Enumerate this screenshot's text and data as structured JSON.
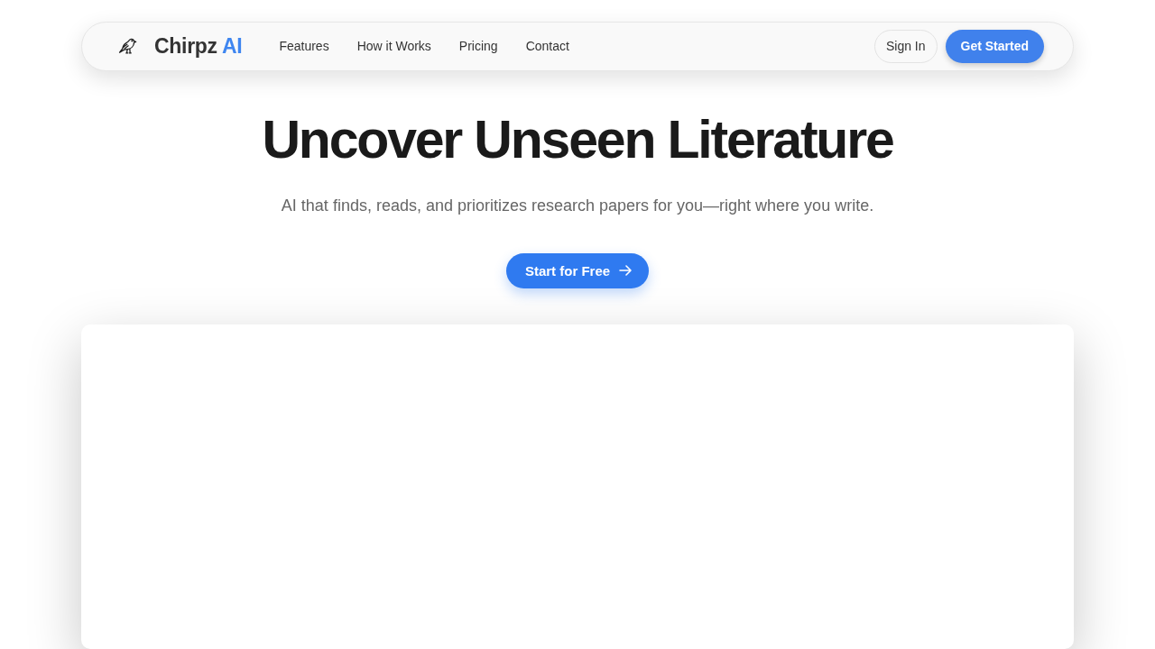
{
  "nav": {
    "brand": {
      "name": "Chirpz",
      "accent": "AI"
    },
    "links": [
      "Features",
      "How it Works",
      "Pricing",
      "Contact"
    ],
    "actions": [
      {
        "label": "Sign In",
        "kind": "secondary"
      },
      {
        "label": "Get Started",
        "kind": "primary"
      }
    ]
  },
  "hero": {
    "title": "Uncover Unseen Literature",
    "subtitle": "AI that finds, reads, and prioritizes research papers for you—right where you write.",
    "cta": {
      "label": "Start for Free"
    }
  }
}
